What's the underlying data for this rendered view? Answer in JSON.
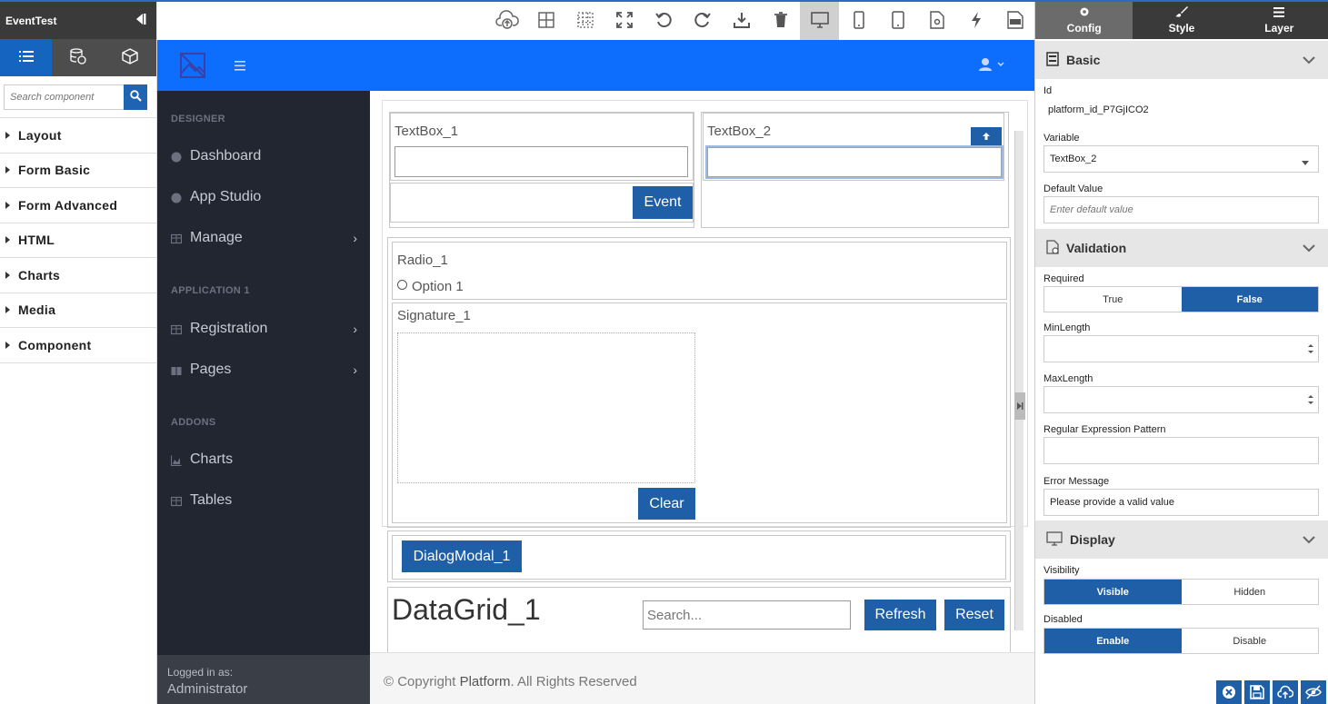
{
  "left_panel": {
    "title": "EventTest",
    "search_placeholder": "Search component",
    "categories": [
      "Layout",
      "Form Basic",
      "Form Advanced",
      "HTML",
      "Charts",
      "Media",
      "Component"
    ]
  },
  "preview": {
    "sidebar": {
      "sections": [
        "DESIGNER",
        "APPLICATION 1",
        "ADDONS"
      ],
      "items": [
        "Dashboard",
        "App Studio",
        "Manage",
        "Registration",
        "Pages",
        "Charts",
        "Tables"
      ],
      "logged_in_label": "Logged in as:",
      "user": "Administrator"
    },
    "footer": {
      "prefix": "© Copyright",
      "brand": "Platform",
      "suffix": ". All Rights Reserved"
    },
    "canvas": {
      "textbox1_label": "TextBox_1",
      "textbox2_label": "TextBox_2",
      "event_button": "Event",
      "radio_label": "Radio_1",
      "radio_option": "Option 1",
      "signature_label": "Signature_1",
      "clear_button": "Clear",
      "dialog_button": "DialogModal_1",
      "datagrid_title": "DataGrid_1",
      "datagrid_search_placeholder": "Search...",
      "refresh_button": "Refresh",
      "reset_button": "Reset"
    }
  },
  "right_panel": {
    "tabs": [
      "Config",
      "Style",
      "Layer"
    ],
    "basic": {
      "title": "Basic",
      "id_label": "Id",
      "id_value": "platform_id_P7GjICO2",
      "variable_label": "Variable",
      "variable_value": "TextBox_2",
      "default_label": "Default Value",
      "default_placeholder": "Enter default value"
    },
    "validation": {
      "title": "Validation",
      "required_label": "Required",
      "true_label": "True",
      "false_label": "False",
      "minlength_label": "MinLength",
      "maxlength_label": "MaxLength",
      "regex_label": "Regular Expression Pattern",
      "error_label": "Error Message",
      "error_value": "Please provide a valid value"
    },
    "display": {
      "title": "Display",
      "visibility_label": "Visibility",
      "visible_label": "Visible",
      "hidden_label": "Hidden",
      "disabled_label": "Disabled",
      "enable_label": "Enable",
      "disable_label": "Disable"
    }
  },
  "colors": {
    "accent": "#1f5fa8",
    "header_blue": "#0d6efd",
    "sidebar_dark": "#212631"
  }
}
